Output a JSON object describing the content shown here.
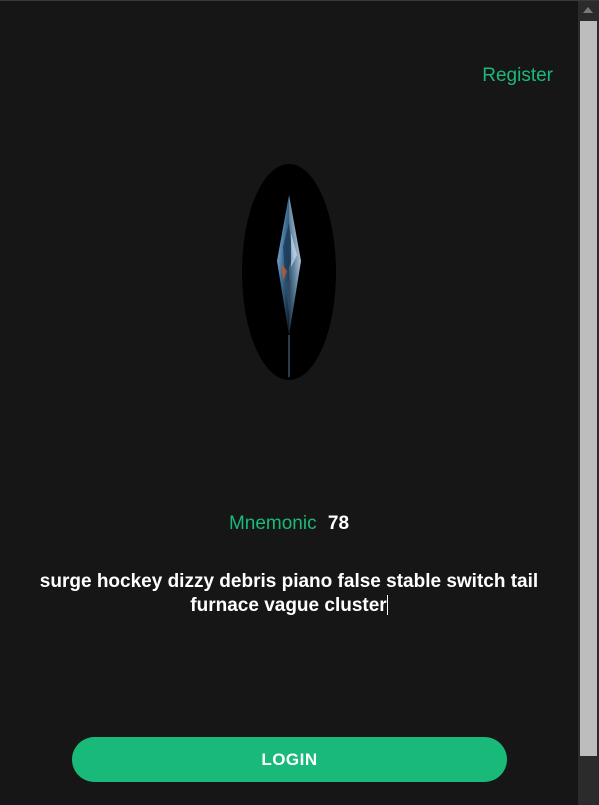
{
  "header": {
    "register_label": "Register"
  },
  "logo": {
    "icon": "crystal-logo-icon"
  },
  "mnemonic": {
    "label": "Mnemonic",
    "count": "78",
    "phrase": "surge hockey dizzy debris piano false stable switch tail furnace vague cluster"
  },
  "actions": {
    "login_label": "LOGIN"
  },
  "colors": {
    "accent": "#19b97a",
    "background": "#161616",
    "text": "#ffffff"
  }
}
